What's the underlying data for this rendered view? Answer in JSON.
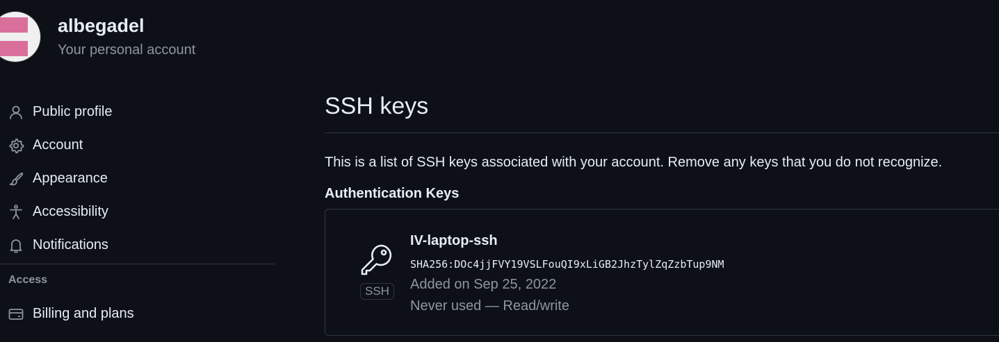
{
  "account": {
    "username": "albegadel",
    "subtitle": "Your personal account"
  },
  "sidebar": {
    "items": [
      {
        "label": "Public profile",
        "icon": "person-icon"
      },
      {
        "label": "Account",
        "icon": "gear-icon"
      },
      {
        "label": "Appearance",
        "icon": "paintbrush-icon"
      },
      {
        "label": "Accessibility",
        "icon": "accessibility-icon"
      },
      {
        "label": "Notifications",
        "icon": "bell-icon"
      }
    ],
    "section_access": "Access",
    "access_items": [
      {
        "label": "Billing and plans",
        "icon": "credit-card-icon"
      }
    ]
  },
  "main": {
    "title": "SSH keys",
    "description": "This is a list of SSH keys associated with your account. Remove any keys that you do not recognize.",
    "auth_heading": "Authentication Keys",
    "keys": [
      {
        "title": "IV-laptop-ssh",
        "fingerprint": "SHA256:DOc4jjFVY19VSLFouQI9xLiGB2JhzTylZqZzbTup9NM",
        "added": "Added on Sep 25, 2022",
        "usage": "Never used — Read/write",
        "badge": "SSH",
        "icon": "key-icon"
      }
    ]
  },
  "colors": {
    "background": "#0d1117",
    "text": "#e6edf3",
    "muted": "#8d96a0",
    "border": "#30363d",
    "avatar_pink": "#d9709c"
  }
}
